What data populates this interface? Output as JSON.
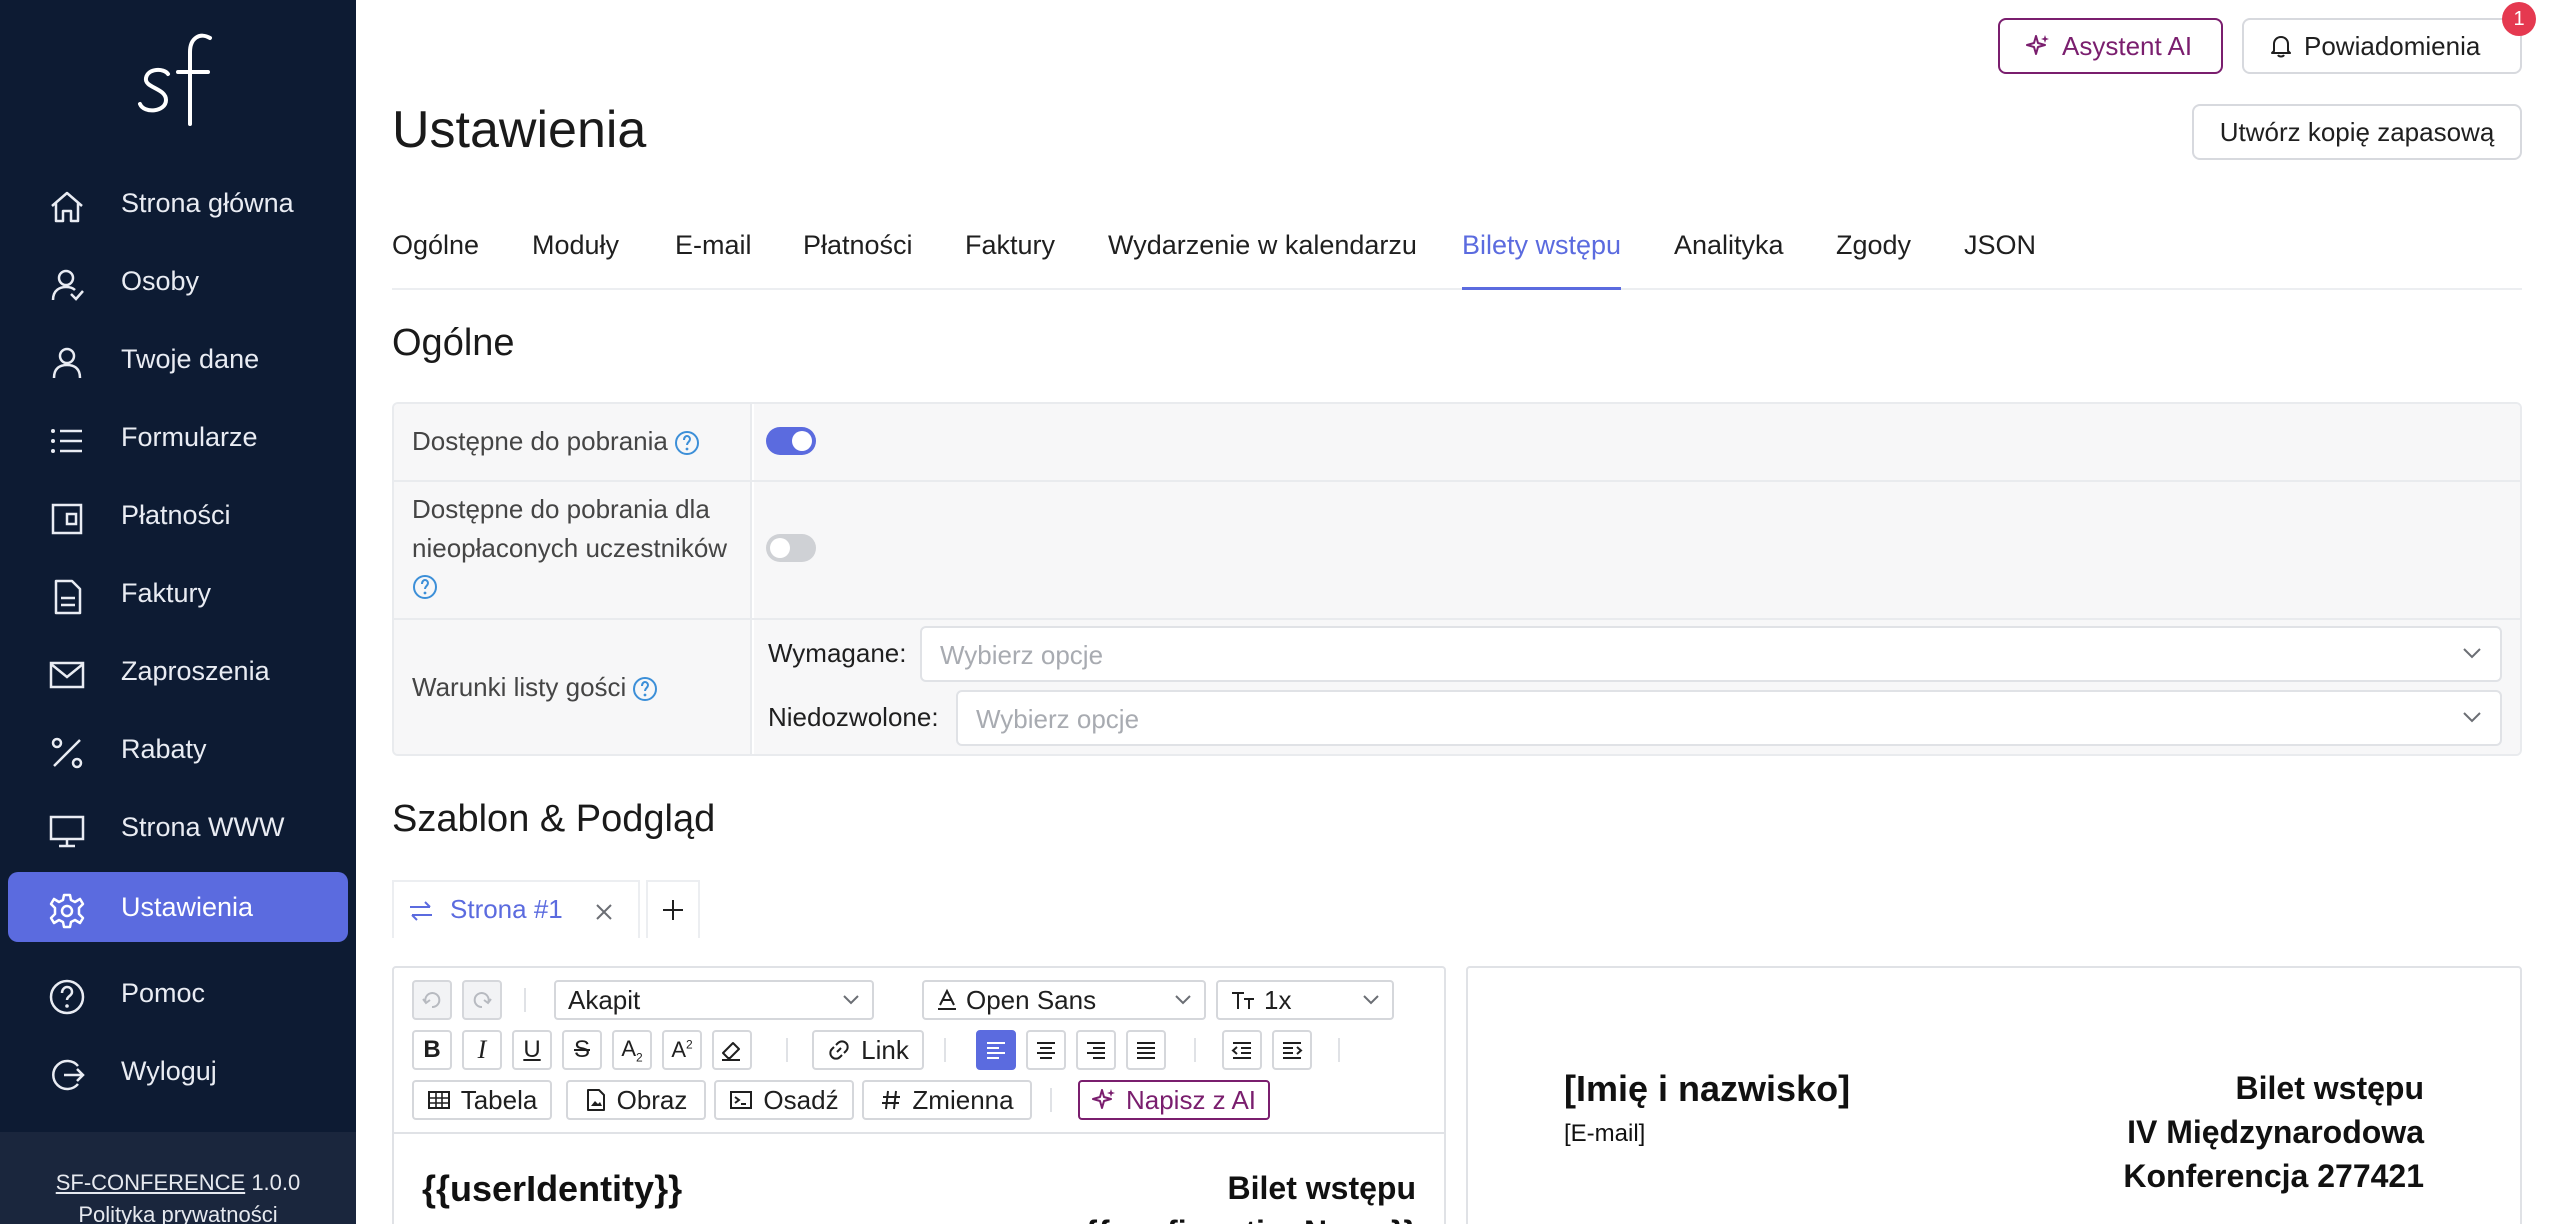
{
  "sidebar": {
    "logo_text": "sf",
    "items": [
      {
        "label": "Strona główna",
        "icon": "home-icon"
      },
      {
        "label": "Osoby",
        "icon": "users-icon"
      },
      {
        "label": "Twoje dane",
        "icon": "user-icon"
      },
      {
        "label": "Formularze",
        "icon": "list-icon"
      },
      {
        "label": "Płatności",
        "icon": "wallet-icon"
      },
      {
        "label": "Faktury",
        "icon": "document-icon"
      },
      {
        "label": "Zaproszenia",
        "icon": "envelope-icon"
      },
      {
        "label": "Rabaty",
        "icon": "percent-icon"
      },
      {
        "label": "Strona WWW",
        "icon": "monitor-icon"
      },
      {
        "label": "Ustawienia",
        "icon": "gear-icon",
        "active": true
      },
      {
        "label": "Pomoc",
        "icon": "help-icon"
      },
      {
        "label": "Wyloguj",
        "icon": "logout-icon"
      }
    ],
    "footer": {
      "product": "SF-CONFERENCE",
      "version": "1.0.0",
      "privacy": "Polityka prywatności"
    }
  },
  "header": {
    "ai_button": "Asystent AI",
    "notifications_button": "Powiadomienia",
    "notifications_count": "1",
    "backup_button": "Utwórz kopię zapasową"
  },
  "page_title": "Ustawienia",
  "tabs": [
    {
      "label": "Ogólne"
    },
    {
      "label": "Moduły"
    },
    {
      "label": "E-mail"
    },
    {
      "label": "Płatności"
    },
    {
      "label": "Faktury"
    },
    {
      "label": "Wydarzenie w kalendarzu"
    },
    {
      "label": "Bilety wstępu",
      "active": true
    },
    {
      "label": "Analityka"
    },
    {
      "label": "Zgody"
    },
    {
      "label": "JSON"
    }
  ],
  "general": {
    "title": "Ogólne",
    "download_label": "Dostępne do pobrania",
    "download_enabled": true,
    "unpaid_label_line1": "Dostępne do pobrania dla",
    "unpaid_label_line2": "nieopłaconych uczestników",
    "unpaid_enabled": false,
    "guestlist_label": "Warunki listy gości",
    "required_label": "Wymagane:",
    "required_placeholder": "Wybierz opcje",
    "forbidden_label": "Niedozwolone:",
    "forbidden_placeholder": "Wybierz opcje"
  },
  "template": {
    "title": "Szablon & Podgląd",
    "page_tab": "Strona #1",
    "toolbar": {
      "paragraph": "Akapit",
      "font": "Open Sans",
      "size": "1x",
      "link": "Link",
      "table": "Tabela",
      "image": "Obraz",
      "embed": "Osadź",
      "variable": "Zmienna",
      "ai_write": "Napisz z AI"
    },
    "editor": {
      "left": "{{userIdentity}}",
      "right_line1": "Bilet wstępu",
      "right_line2": "{{confirmationName}}"
    },
    "preview": {
      "name": "[Imię i nazwisko]",
      "email": "[E-mail]",
      "right_line1": "Bilet wstępu",
      "right_line2": "IV Międzynarodowa",
      "right_line3": "Konferencja 277421"
    }
  },
  "colors": {
    "sidebar_bg": "#0d1b33",
    "accent": "#5b6bdf",
    "ai": "#7a1e6e",
    "badge": "#e53950"
  }
}
